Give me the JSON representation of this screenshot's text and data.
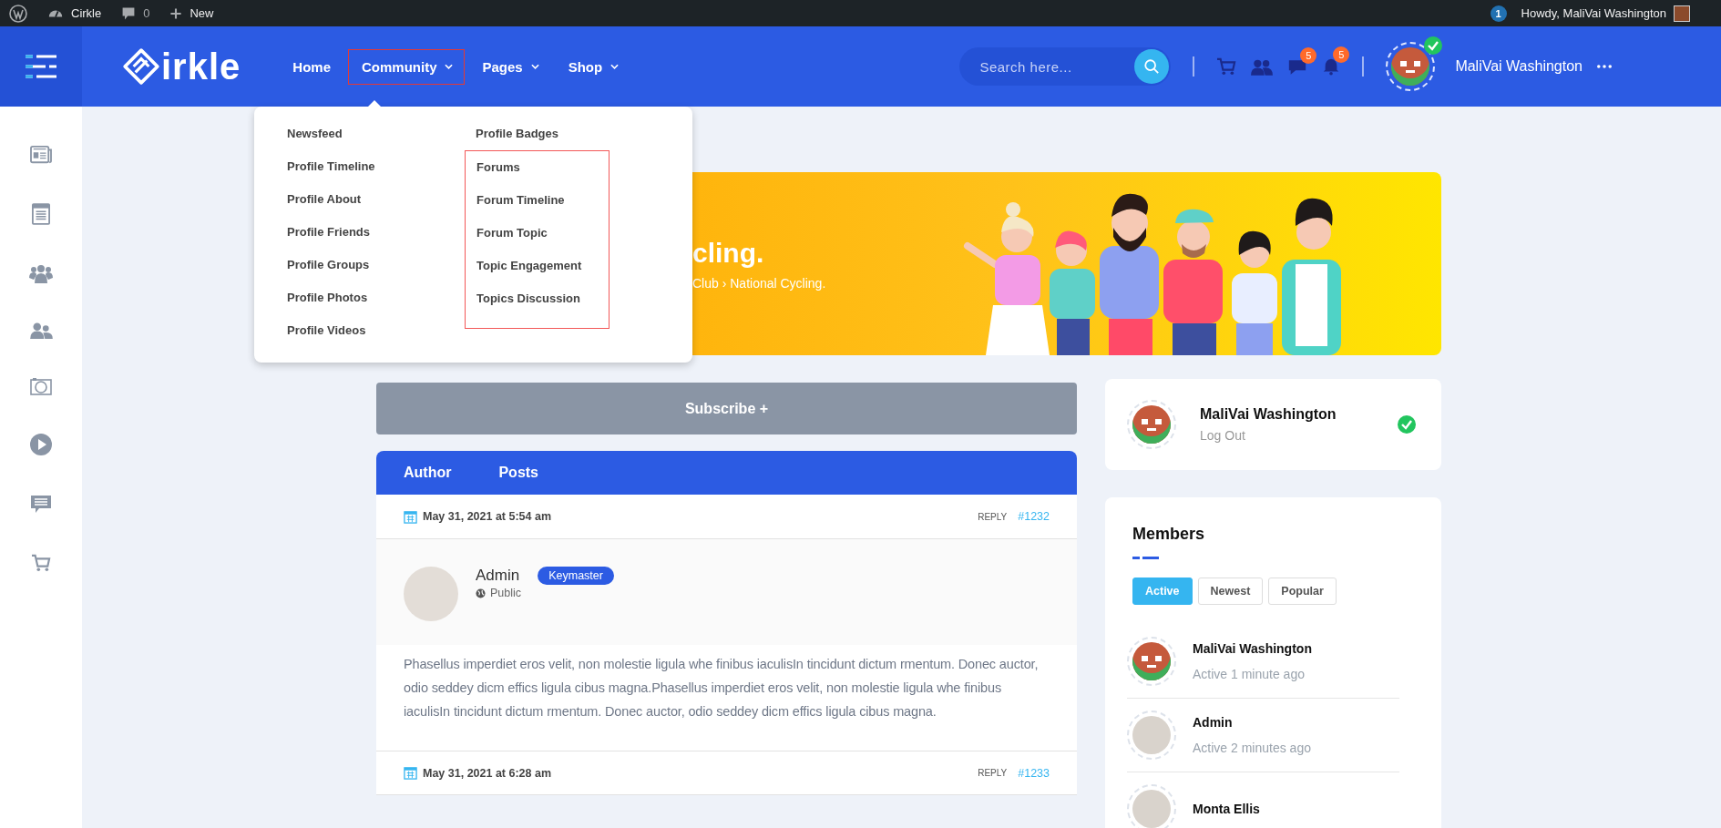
{
  "admin_bar": {
    "site": "Cirkle",
    "comments": "0",
    "new": "New",
    "updates": "1",
    "greeting": "Howdy, MaliVai Washington"
  },
  "header": {
    "logo": "irkle",
    "nav": [
      {
        "label": "Home",
        "has_dropdown": false,
        "outlined": false
      },
      {
        "label": "Community",
        "has_dropdown": true,
        "outlined": true
      },
      {
        "label": "Pages",
        "has_dropdown": true,
        "outlined": false
      },
      {
        "label": "Shop",
        "has_dropdown": true,
        "outlined": false
      }
    ],
    "search": {
      "placeholder": "Search here..."
    },
    "messages_badge": "5",
    "notifications_badge": "5",
    "user": {
      "name": "MaliVai Washington",
      "online": true
    }
  },
  "sidebar": {
    "items": [
      {
        "kind": "newspaper"
      },
      {
        "kind": "article"
      },
      {
        "kind": "groups"
      },
      {
        "kind": "friends"
      },
      {
        "kind": "camera"
      },
      {
        "kind": "play"
      },
      {
        "kind": "chat"
      },
      {
        "kind": "cart"
      }
    ]
  },
  "dropdown": {
    "columns": [
      {
        "items": [
          "Newsfeed",
          "Profile Timeline",
          "Profile About",
          "Profile Friends",
          "Profile Groups",
          "Profile Photos",
          "Profile Videos"
        ]
      },
      {
        "items": [
          "Profile Badges"
        ],
        "outlined_items": [
          "Forums",
          "Forum Timeline",
          "Forum Topic",
          "Topic Engagement",
          "Topics Discussion"
        ]
      }
    ]
  },
  "banner": {
    "title": "cling.",
    "breadcrumb": "Club › National Cycling."
  },
  "subscribe_button": "Subscribe +",
  "topic": {
    "columns": [
      "Author",
      "Posts"
    ],
    "posts": [
      {
        "date": "May 31, 2021 at 5:54 am",
        "reply": "REPLY",
        "number": "#1232",
        "author": "Admin",
        "role": "Keymaster",
        "visibility": "Public",
        "text": "Phasellus imperdiet eros velit, non molestie ligula whe finibus iaculisIn tincidunt dictum rmentum. Donec auctor, odio seddey dicm effics ligula cibus magna.Phasellus imperdiet eros velit, non molestie ligula whe finibus iaculisIn tincidunt dictum rmentum. Donec auctor, odio seddey dicm effics ligula cibus magna."
      },
      {
        "date": "May 31, 2021 at 6:28 am",
        "reply": "REPLY",
        "number": "#1233"
      }
    ]
  },
  "profile_card": {
    "name": "MaliVai Washington",
    "link": "Log Out",
    "verified": true
  },
  "members": {
    "title": "Members",
    "filters": [
      {
        "label": "Active",
        "selected": true
      },
      {
        "label": "Newest",
        "selected": false
      },
      {
        "label": "Popular",
        "selected": false
      }
    ],
    "list": [
      {
        "name": "MaliVai Washington",
        "status": "Active 1 minute ago",
        "kind": "pixel"
      },
      {
        "name": "Admin",
        "status": "Active 2 minutes ago",
        "kind": "photo"
      },
      {
        "name": "Monta Ellis",
        "kind": "photo"
      }
    ]
  }
}
